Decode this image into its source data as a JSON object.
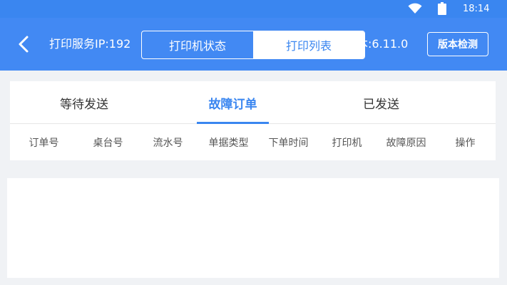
{
  "status_bar": {
    "time": "18:14",
    "wifi_icon": "wifi-icon",
    "battery_icon": "battery-icon"
  },
  "header": {
    "back_icon": "chevron-left-icon",
    "server_ip_label": "打印服务IP:192",
    "version_label": "本:6.11.0",
    "segments": [
      {
        "label": "打印机状态",
        "active": false
      },
      {
        "label": "打印列表",
        "active": true
      }
    ],
    "check_version_label": "版本检测"
  },
  "tabs": [
    {
      "label": "等待发送",
      "active": false
    },
    {
      "label": "故障订单",
      "active": true
    },
    {
      "label": "已发送",
      "active": false
    }
  ],
  "table": {
    "columns": [
      "订单号",
      "桌台号",
      "流水号",
      "单据类型",
      "下单时间",
      "打印机",
      "故障原因",
      "操作"
    ],
    "rows": []
  },
  "colors": {
    "primary": "#4289f3",
    "status_bar": "#3a86f0",
    "accent": "#3a86f0",
    "background": "#f0f2f5"
  }
}
